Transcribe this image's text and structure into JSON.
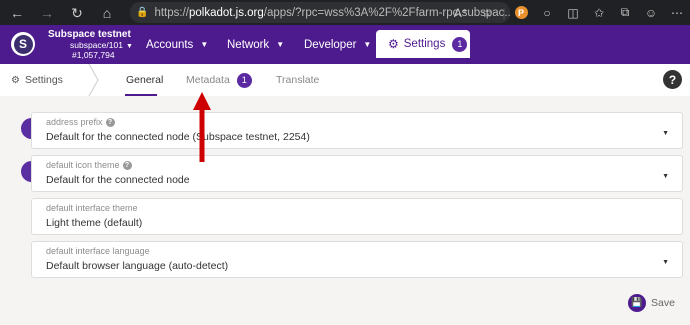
{
  "browser": {
    "url_prefix": "https://",
    "url_host": "polkadot.js.org",
    "url_rest": "/apps/?rpc=wss%3A%2F%2Ffarm-rpc.subspac...",
    "extension_label": "P"
  },
  "header": {
    "chain_logo_letter": "S",
    "chain_name": "Subspace testnet",
    "chain_spec": "subspace/101",
    "block_number": "#1,057,794",
    "menus": [
      {
        "label": "Accounts"
      },
      {
        "label": "Network"
      },
      {
        "label": "Developer"
      }
    ],
    "settings_label": "Settings",
    "settings_badge": "1"
  },
  "subbar": {
    "title": "Settings",
    "tabs": [
      {
        "label": "General",
        "active": true
      },
      {
        "label": "Metadata",
        "badge": "1"
      },
      {
        "label": "Translate"
      }
    ],
    "help_label": "?"
  },
  "form": {
    "fields": [
      {
        "label": "address prefix",
        "help": "?",
        "value": "Default for the connected node (Subspace testnet, 2254)"
      },
      {
        "label": "default icon theme",
        "help": "?",
        "value": "Default for the connected node"
      },
      {
        "label": "default interface theme",
        "value": "Light theme (default)"
      },
      {
        "label": "default interface language",
        "value": "Default browser language (auto-detect)"
      }
    ],
    "save_label": "Save"
  },
  "colors": {
    "header_purple": "#4e1b8f",
    "annotation_arrow": "#cc0000"
  }
}
